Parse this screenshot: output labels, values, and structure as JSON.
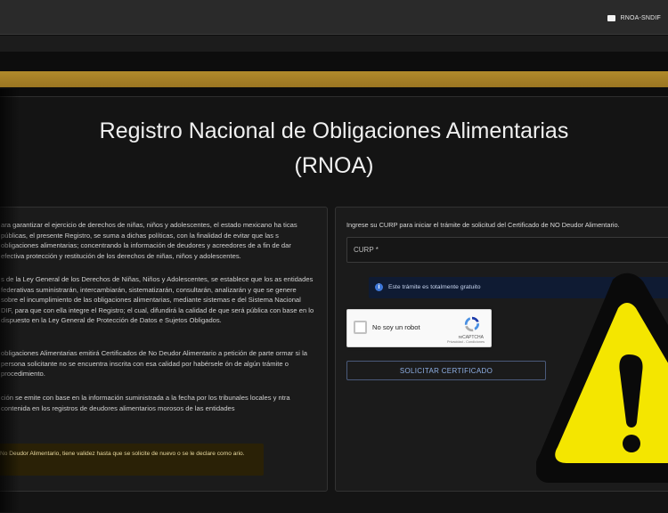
{
  "header": {
    "brand": "RNOA-SNDIF"
  },
  "page": {
    "title_line1": "Registro Nacional de Obligaciones Alimentarias",
    "title_line2": "(RNOA)"
  },
  "left": {
    "p1": "ara garantizar el ejercicio de derechos de niñas, niños y adolescentes, el estado mexicano ha ticas públicas, el presente Registro, se suma a dichas políticas, con la finalidad de evitar que las s obligaciones alimentarias; concentrando la información de deudores y acreedores de a fin de dar efectiva protección y restitución de los derechos de niñas, niños y adolescentes.",
    "p2": "s de la Ley General de los Derechos de Niñas, Niños y Adolescentes, se establece que los as entidades federativas suministrarán, intercambiarán, sistematizarán, consultarán, analizarán y que se genere sobre el incumplimiento de las obligaciones alimentarias, mediante sistemas e del Sistema Nacional DIF, para que con ella integre el Registro; el cual, difundirá la calidad de que será pública con base en lo dispuesto en la Ley General de Protección de Datos e Sujetos Obligados.",
    "p3": "obligaciones Alimentarias emitirá Certificados de No Deudor Alimentario a petición de parte ormar si la persona solicitante no se encuentra inscrita con esa calidad por habérsele ón de algún trámite o procedimiento.",
    "p4": "ción se emite con base en la información suministrada a la fecha por los tribunales locales y ntra contenida en los registros de deudores alimentarios morosos de las entidades",
    "notice": "No Deudor Alimentario, tiene validez hasta que se solicite de nuevo o se le declare como ario."
  },
  "form": {
    "instruction": "Ingrese su CURP para iniciar el trámite de solicitud del Certificado de NO Deudor Alimentario.",
    "curp_label": "CURP *",
    "info_icon": "i",
    "info_text": "Este trámite es totalmente gratuito",
    "captcha_label": "No soy un robot",
    "captcha_brand": "reCAPTCHA",
    "captcha_links": "Privacidad - Condiciones",
    "submit_label": "SOLICITAR CERTIFICADO"
  },
  "colors": {
    "gold_band": "#b08a2b",
    "accent_blue": "#8fb0e6",
    "warning_yellow": "#f4e600"
  },
  "icons": {
    "overlay": "warning-triangle-icon",
    "recaptcha": "recaptcha-logo-icon",
    "flag": "flag-icon"
  }
}
